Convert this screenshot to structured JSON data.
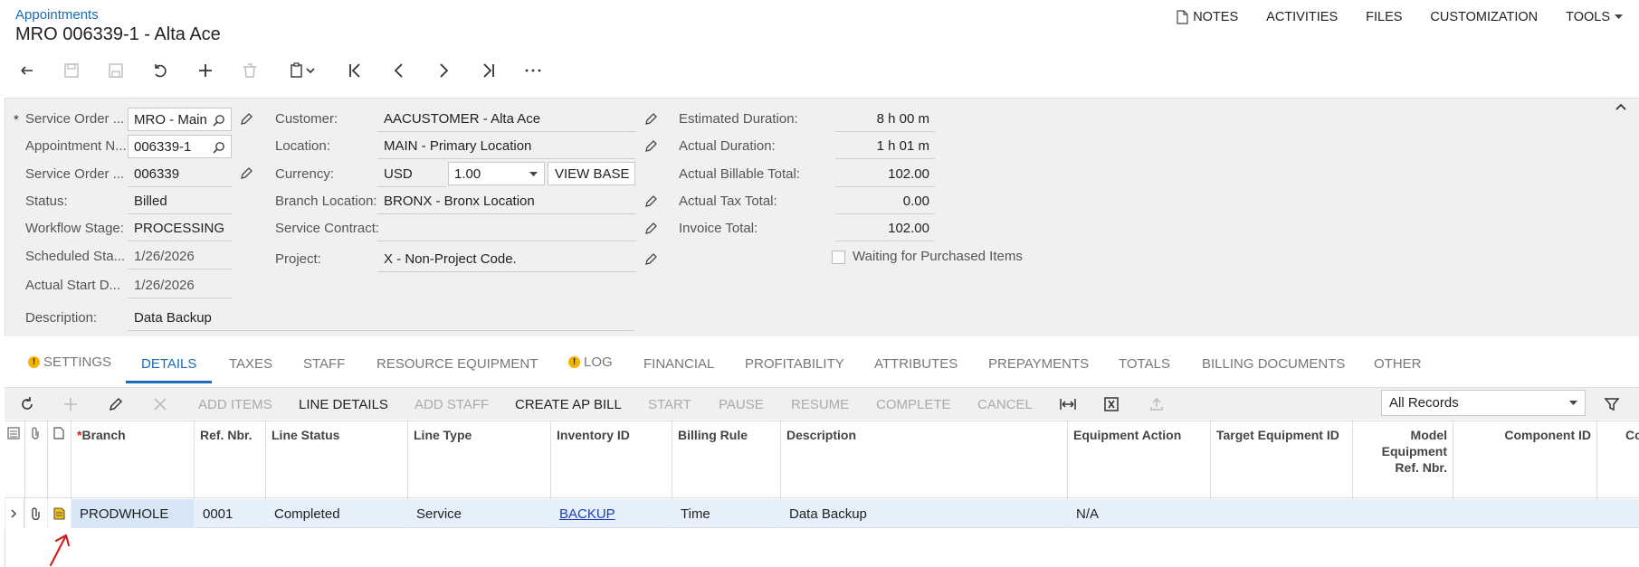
{
  "header": {
    "breadcrumb": "Appointments",
    "title": "MRO 006339-1 - Alta Ace"
  },
  "topnav": {
    "notes": "NOTES",
    "activities": "ACTIVITIES",
    "files": "FILES",
    "customization": "CUSTOMIZATION",
    "tools": "TOOLS"
  },
  "form": {
    "col1": {
      "service_order_type_label": "Service Order ...",
      "service_order_type_value": "MRO - Main",
      "appointment_nbr_label": "Appointment N...",
      "appointment_nbr_value": "006339-1",
      "service_order_nbr_label": "Service Order ...",
      "service_order_nbr_value": "006339",
      "status_label": "Status:",
      "status_value": "Billed",
      "workflow_stage_label": "Workflow Stage:",
      "workflow_stage_value": "PROCESSING",
      "scheduled_start_label": "Scheduled Sta...",
      "scheduled_start_value": "1/26/2026",
      "actual_start_label": "Actual Start D...",
      "actual_start_value": "1/26/2026",
      "description_label": "Description:",
      "description_value": "Data Backup"
    },
    "col2": {
      "customer_label": "Customer:",
      "customer_value": "AACUSTOMER - Alta Ace",
      "location_label": "Location:",
      "location_value": "MAIN - Primary Location",
      "currency_label": "Currency:",
      "currency_value": "USD",
      "rate_value": "1.00",
      "view_base_label": "VIEW BASE",
      "branch_location_label": "Branch Location:",
      "branch_location_value": "BRONX - Bronx Location",
      "service_contract_label": "Service Contract:",
      "service_contract_value": "",
      "project_label": "Project:",
      "project_value": "X - Non-Project Code."
    },
    "col3": {
      "estimated_duration_label": "Estimated Duration:",
      "estimated_duration_value": "8 h 00 m",
      "actual_duration_label": "Actual Duration:",
      "actual_duration_value": "1 h 01 m",
      "actual_billable_total_label": "Actual Billable Total:",
      "actual_billable_total_value": "102.00",
      "actual_tax_total_label": "Actual Tax Total:",
      "actual_tax_total_value": "0.00",
      "invoice_total_label": "Invoice Total:",
      "invoice_total_value": "102.00",
      "waiting_label": "Waiting for Purchased Items",
      "waiting_checked": false
    }
  },
  "tabs": [
    {
      "label": "SETTINGS",
      "warning": true
    },
    {
      "label": "DETAILS",
      "active": true
    },
    {
      "label": "TAXES"
    },
    {
      "label": "STAFF"
    },
    {
      "label": "RESOURCE EQUIPMENT"
    },
    {
      "label": "LOG",
      "warning": true
    },
    {
      "label": "FINANCIAL"
    },
    {
      "label": "PROFITABILITY"
    },
    {
      "label": "ATTRIBUTES"
    },
    {
      "label": "PREPAYMENTS"
    },
    {
      "label": "TOTALS"
    },
    {
      "label": "BILLING DOCUMENTS"
    },
    {
      "label": "OTHER"
    }
  ],
  "grid_toolbar": {
    "add_items": "ADD ITEMS",
    "line_details": "LINE DETAILS",
    "add_staff": "ADD STAFF",
    "create_ap_bill": "CREATE AP BILL",
    "start": "START",
    "pause": "PAUSE",
    "resume": "RESUME",
    "complete": "COMPLETE",
    "cancel": "CANCEL",
    "records_filter": "All Records"
  },
  "grid": {
    "columns": {
      "branch": "Branch",
      "ref_nbr": "Ref. Nbr.",
      "line_status": "Line Status",
      "line_type": "Line Type",
      "inventory_id": "Inventory ID",
      "billing_rule": "Billing Rule",
      "description": "Description",
      "equipment_action": "Equipment Action",
      "target_equipment_id": "Target Equipment ID",
      "model_equipment_ref_nbr": "Model Equipment Ref. Nbr.",
      "component_id": "Component ID",
      "co": "Co"
    },
    "rows": [
      {
        "branch": "PRODWHOLE",
        "ref_nbr": "0001",
        "line_status": "Completed",
        "line_type": "Service",
        "inventory_id": "BACKUP",
        "billing_rule": "Time",
        "description": "Data Backup",
        "equipment_action": "N/A"
      }
    ]
  },
  "colors": {
    "link": "#1a6bb8",
    "active_tab": "#1a6bb8",
    "panel_bg": "#f0f0f0",
    "row_selected": "#e6f0fa",
    "warning": "#f2b400",
    "annotation": "#d42020"
  }
}
